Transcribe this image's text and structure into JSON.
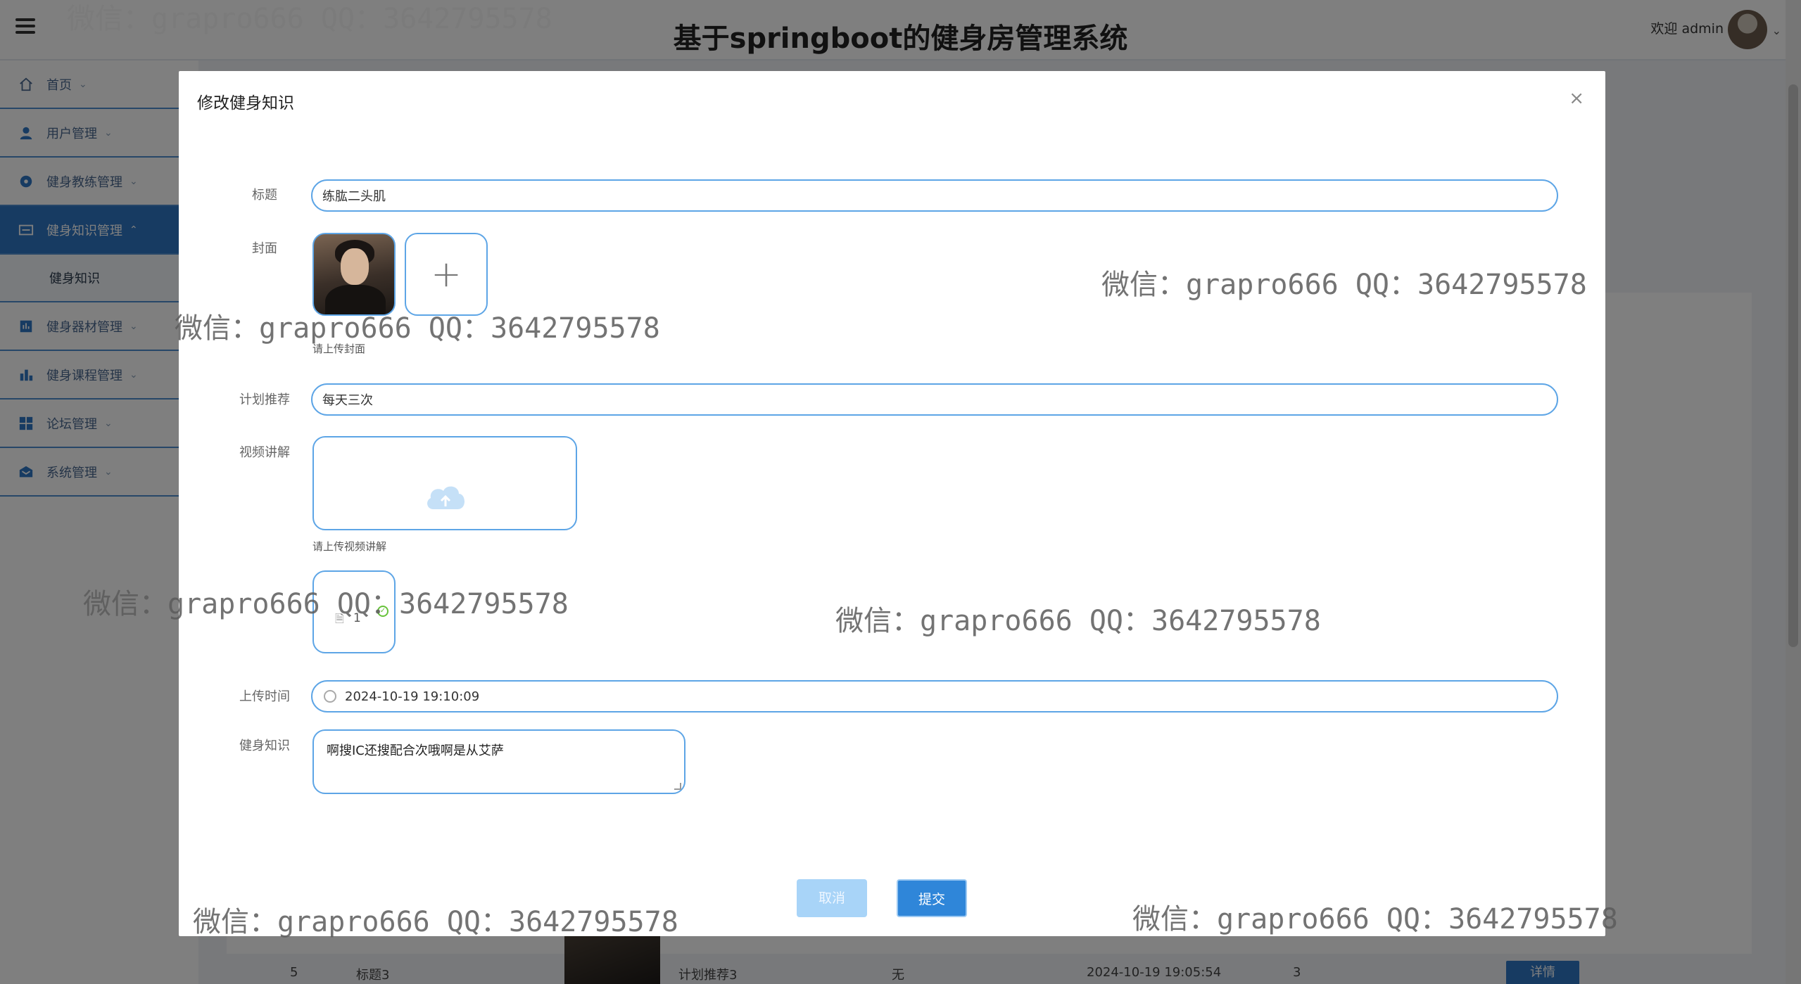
{
  "app": {
    "title": "基于springboot的健身房管理系统",
    "welcome": "欢迎 admin"
  },
  "sidebar": {
    "items": [
      {
        "label": "首页",
        "icon": "home-icon"
      },
      {
        "label": "用户管理",
        "icon": "user-icon"
      },
      {
        "label": "健身教练管理",
        "icon": "coach-icon"
      },
      {
        "label": "健身知识管理",
        "icon": "knowledge-icon",
        "active": true
      },
      {
        "label": "健身知识",
        "sub": true
      },
      {
        "label": "健身器材管理",
        "icon": "equipment-icon"
      },
      {
        "label": "健身课程管理",
        "icon": "course-icon"
      },
      {
        "label": "论坛管理",
        "icon": "forum-icon"
      },
      {
        "label": "系统管理",
        "icon": "system-icon"
      }
    ]
  },
  "background_row": {
    "index": "5",
    "title": "标题3",
    "plan": "计划推荐3",
    "video": "无",
    "time": "2024-10-19 19:05:54",
    "count": "3",
    "detail_button": "详情"
  },
  "dialog": {
    "title": "修改健身知识",
    "close_icon": "×",
    "fields": {
      "title_label": "标题",
      "title_value": "练肱二头肌",
      "cover_label": "封面",
      "cover_hint": "请上传封面",
      "plan_label": "计划推荐",
      "plan_value": "每天三次",
      "video_label": "视频讲解",
      "video_hint": "请上传视频讲解",
      "file_name": "1",
      "time_label": "上传时间",
      "time_value": "2024-10-19 19:10:09",
      "knowledge_label": "健身知识",
      "knowledge_value": "啊搜IC还搜配合次哦啊是从艾萨"
    },
    "buttons": {
      "cancel": "取消",
      "submit": "提交"
    }
  },
  "watermark_text": "微信：grapro666 QQ：3642795578",
  "colors": {
    "primary": "#2f76c4",
    "input_border": "#5da5e6",
    "success": "#67c23a"
  }
}
